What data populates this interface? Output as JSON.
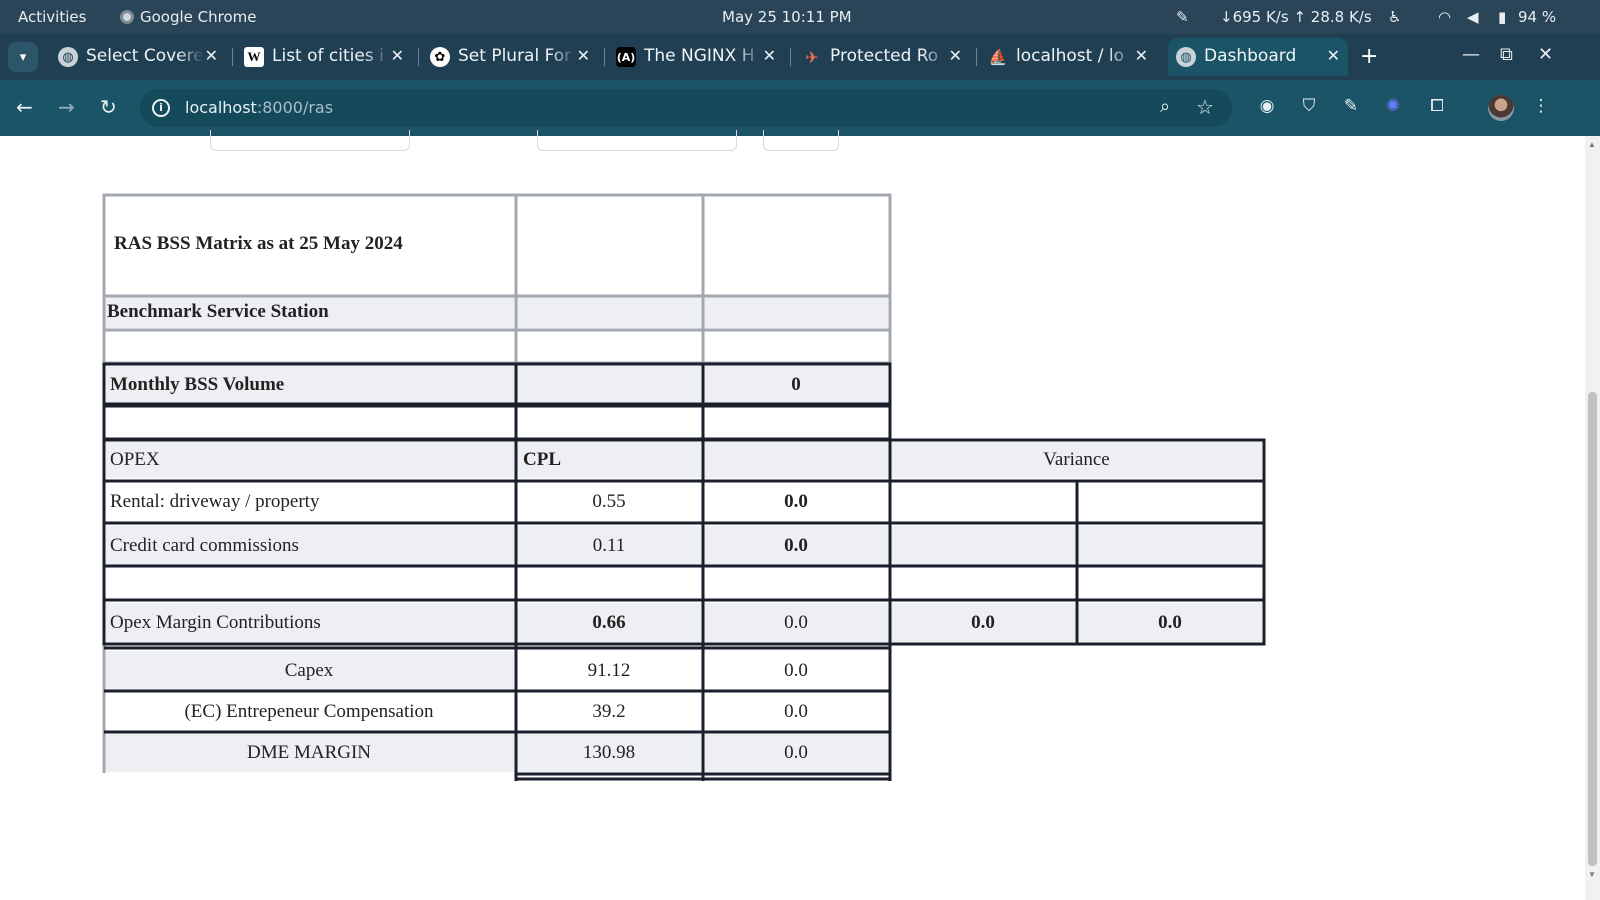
{
  "system_bar": {
    "activities": "Activities",
    "app_name": "Google Chrome",
    "datetime": "May 25  10:11 PM",
    "network_speed": "↓695 K/s ↑ 28.8 K/s",
    "battery": "94 %"
  },
  "tabs": [
    {
      "title": "Select Covere",
      "favicon": "globe-icon"
    },
    {
      "title": "List of cities i",
      "favicon": "wikipedia-icon"
    },
    {
      "title": "Set Plural For",
      "favicon": "openai-icon"
    },
    {
      "title": "The NGINX H",
      "favicon": "nginx-icon"
    },
    {
      "title": "Protected Ro",
      "favicon": "protected-route-icon"
    },
    {
      "title": "localhost / lo",
      "favicon": "phpmyadmin-icon"
    },
    {
      "title": "Dashboard",
      "favicon": "globe-icon",
      "active": true
    }
  ],
  "address_bar": {
    "host": "localhost",
    "path": ":8000/ras"
  },
  "table": {
    "title": "RAS BSS Matrix as at 25 May 2024",
    "benchmark_label": "Benchmark Service Station",
    "monthly_volume": {
      "label": "Monthly BSS Volume",
      "value": "0"
    },
    "opex_header": {
      "label": "OPEX",
      "cpl": "CPL",
      "variance": "Variance"
    },
    "rows": [
      {
        "label": "Rental: driveway / property",
        "cpl": "0.55",
        "value": "0.0"
      },
      {
        "label": "Credit card commissions",
        "cpl": "0.11",
        "value": "0.0"
      }
    ],
    "opex_margin": {
      "label": "Opex Margin Contributions",
      "cpl": "0.66",
      "value": "0.0",
      "variance_1": "0.0",
      "variance_2": "0.0"
    },
    "summary": [
      {
        "label": "Capex",
        "cpl": "91.12",
        "value": "0.0"
      },
      {
        "label": "(EC) Entrepeneur Compensation",
        "cpl": "39.2",
        "value": "0.0"
      },
      {
        "label": "DME MARGIN",
        "cpl": "130.98",
        "value": "0.0"
      }
    ]
  }
}
